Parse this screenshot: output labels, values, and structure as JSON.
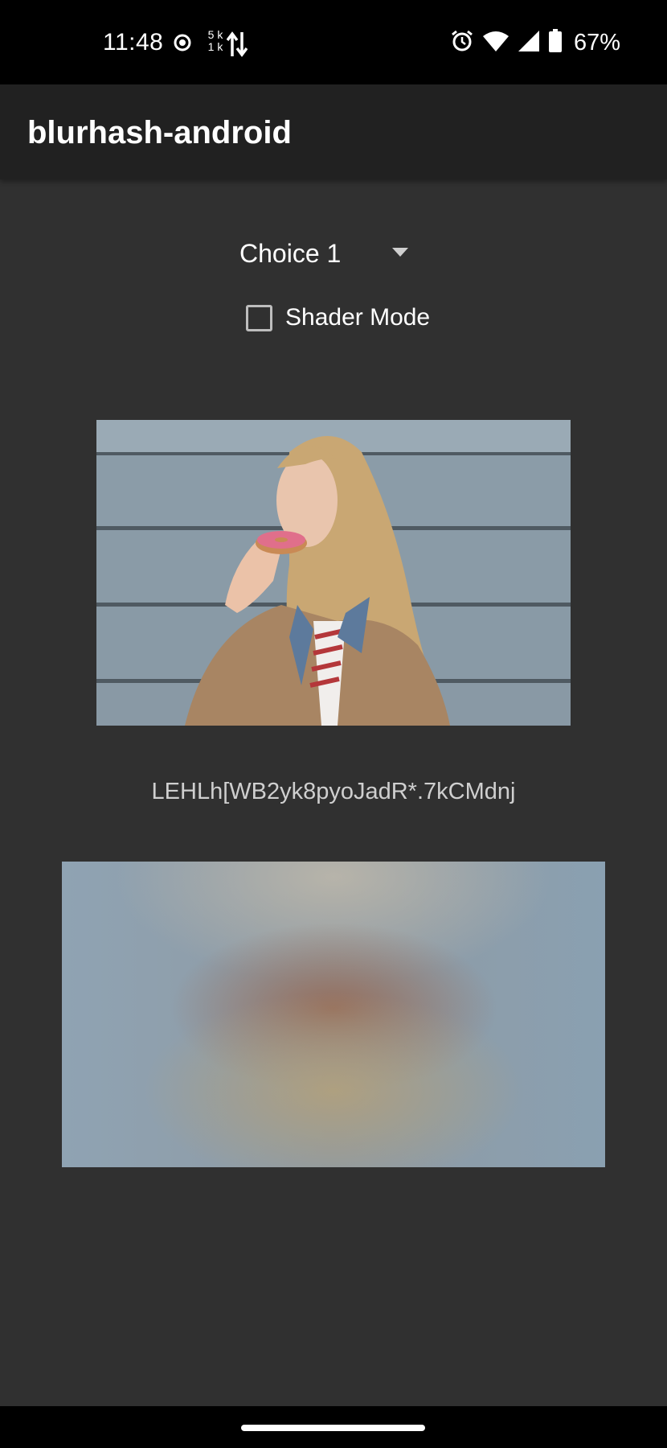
{
  "status_bar": {
    "time": "11:48",
    "rate_up": "5 k",
    "rate_down": "1 k",
    "battery_percent": "67%",
    "icons": [
      "record-icon",
      "data-transfer-icon",
      "alarm-icon",
      "wifi-icon",
      "cell-signal-icon",
      "battery-icon"
    ]
  },
  "app_bar": {
    "title": "blurhash-android"
  },
  "controls": {
    "spinner_selected": "Choice 1",
    "checkbox_label": "Shader Mode",
    "checkbox_checked": false
  },
  "content": {
    "photo_icon": "sample-photo-woman-eating-donut",
    "hash": "LEHLh[WB2yk8pyoJadR*.7kCMdnj",
    "blur_icon": "blurhash-preview"
  },
  "colors": {
    "background": "#303030",
    "app_bar": "#212121",
    "status_bar": "#000000"
  }
}
